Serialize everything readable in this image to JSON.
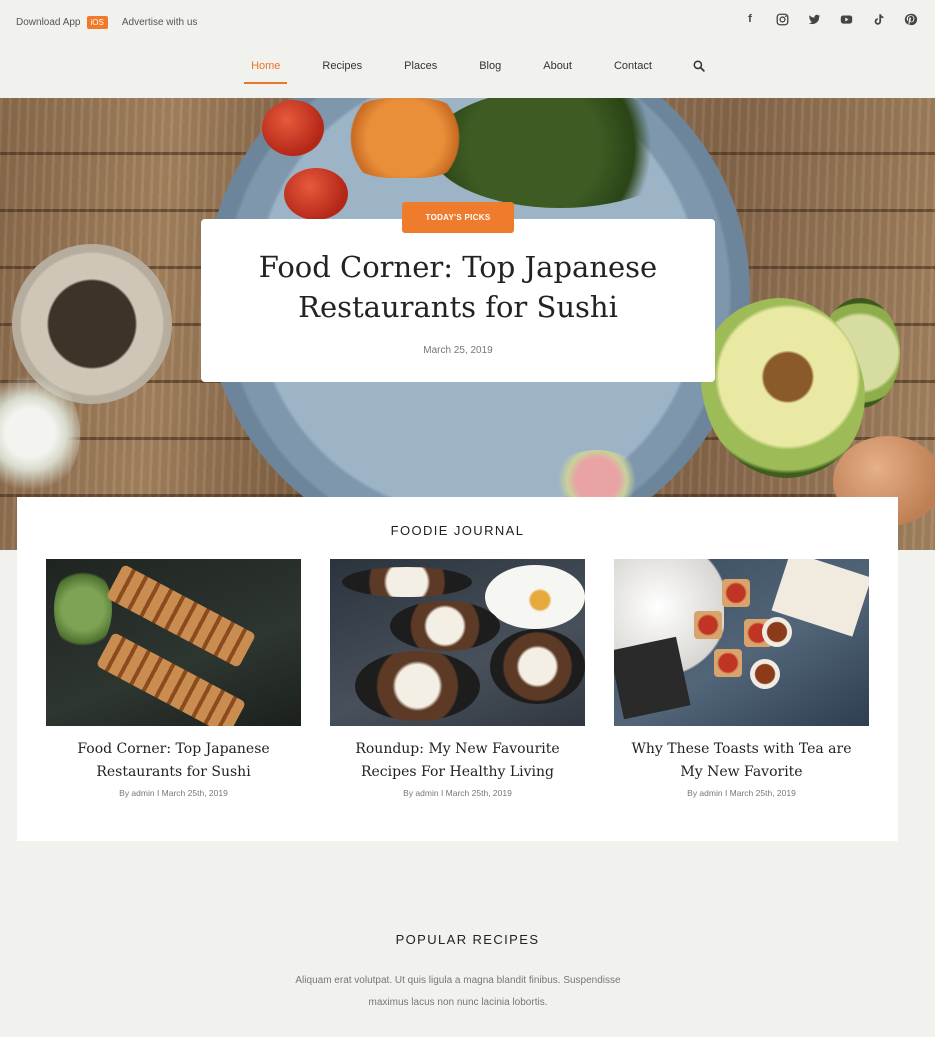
{
  "topbar": {
    "download_app": "Download App",
    "ios_badge": "iOS",
    "advertise": "Advertise with us"
  },
  "social": [
    "facebook-icon",
    "instagram-icon",
    "twitter-icon",
    "youtube-icon",
    "tiktok-icon",
    "pinterest-icon"
  ],
  "nav": {
    "items": [
      "Home",
      "Recipes",
      "Places",
      "Blog",
      "About",
      "Contact"
    ],
    "active": "Home",
    "accent_color": "#e8762b"
  },
  "hero": {
    "tag": "TODAY'S PICKS",
    "title_line1": "Food Corner: Top Japanese",
    "title_line2": "Restaurants for Sushi",
    "date": "March 25, 2019"
  },
  "journal": {
    "heading": "FOODIE JOURNAL",
    "posts": [
      {
        "title_line1": "Food Corner: Top Japanese",
        "title_line2": "Restaurants for Sushi",
        "meta": "By admin I March 25th, 2019"
      },
      {
        "title_line1": "Roundup: My New Favourite",
        "title_line2": "Recipes For Healthy Living",
        "meta": "By admin I March 25th, 2019"
      },
      {
        "title_line1": "Why These Toasts with Tea are",
        "title_line2": "My New Favorite",
        "meta": "By admin I March 25th, 2019"
      }
    ]
  },
  "popular": {
    "heading": "POPULAR RECIPES",
    "desc_line1": "Aliquam erat volutpat. Ut quis ligula a magna blandit finibus. Suspendisse",
    "desc_line2": "maximus lacus non nunc lacinia lobortis."
  }
}
